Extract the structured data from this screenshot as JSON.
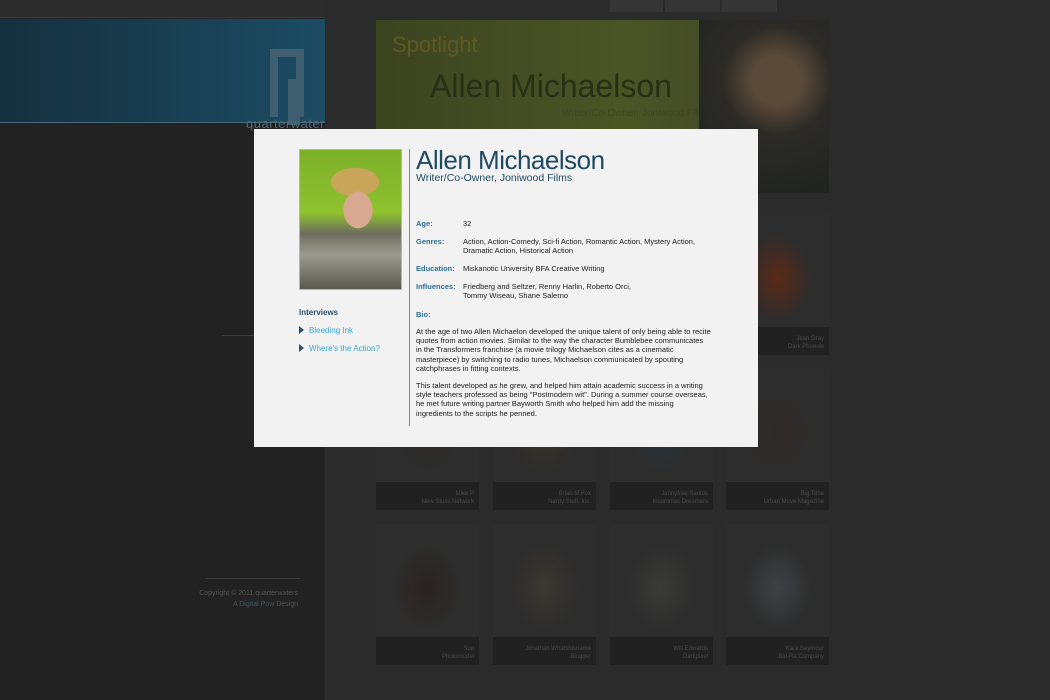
{
  "background": {
    "brand_name": "quarterwaters",
    "top_nav": [
      "",
      "",
      ""
    ],
    "spotlight": {
      "label": "Spotlight",
      "name": "Allen Michaelson",
      "title": "Writer/Co-Owner, Joniwood Films"
    },
    "tiles": [
      {
        "line1": "Jean Gray",
        "line2": "Dark Phoenix",
        "color": "#5b2a16"
      },
      {
        "line1": "Mike P",
        "line2": "New Stuss Network",
        "color": "#2e2a28"
      },
      {
        "line1": "Brian M Fox",
        "line2": "Nerdy Stuff, Inc.",
        "color": "#3a332c"
      },
      {
        "line1": "Jennyfree Santos",
        "line2": "Insomniac Dreamers",
        "color": "#27343a"
      },
      {
        "line1": "Big Time",
        "line2": "Urban Move Magazine",
        "color": "#2f2a26"
      },
      {
        "line1": "Soo",
        "line2": "Photomodel",
        "color": "#2a231f"
      },
      {
        "line1": "Jonathan Whatshisname",
        "line2": "Blogger",
        "color": "#3c3730"
      },
      {
        "line1": "Will Edwards",
        "line2": "Darkpixel",
        "color": "#3a3a38"
      },
      {
        "line1": "Kara Seymour",
        "line2": "Blu-Ra Company",
        "color": "#3e4246"
      }
    ],
    "copyright": {
      "line1": "Copyright © 2011 quarterwaters",
      "line2_prefix": "A",
      "line2_mid": "Digital Pow",
      "line2_suffix": "Design"
    }
  },
  "modal": {
    "name": "Allen Michaelson",
    "subtitle": "Writer/Co-Owner, Joniwood Films",
    "interviews_title": "Interviews",
    "interviews": [
      "Bleeding Ink",
      "Where's the Action?"
    ],
    "fields": {
      "age_label": "Age:",
      "age_value": "32",
      "genres_label": "Genres:",
      "genres_value": "Action, Action-Comedy, Sci-fi Action, Romantic Action, Mystery Action, Dramatic Action, Historical Action",
      "education_label": "Education:",
      "education_value": "Miskanotic University BFA Creative Writing",
      "influences_label": "Influences:",
      "influences_value": "Friedberg and Seltzer, Renny Harlin, Roberto Orci, Tommy Wiseau, Shane Salerno"
    },
    "bio_label": "Bio:",
    "bio_paragraphs": [
      "At the age of two Allen Michaelon developed the unique talent of only being able to recite quotes from action movies. Similar to the way the character Bumblebee communicates in the Transformers franchise (a movie trilogy Michaelson cites as a cinematic masterpiece) by switching to radio tunes, Michaelson communicated by spouting catchphrases in fitting contexts.",
      "This talent developed as he grew, and helped him attain academic success in a writing style teachers professed as being \"Postmodern wit\". During a summer course overseas, he met future writing partner Bayworth Smith who helped him add the missing ingredients to the scripts he penned."
    ]
  }
}
